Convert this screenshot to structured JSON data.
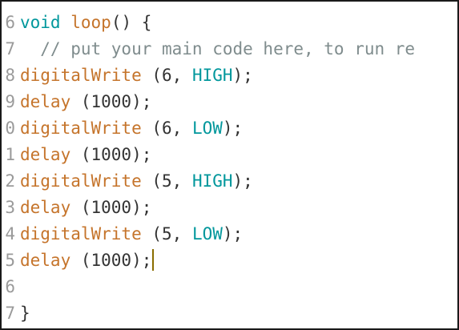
{
  "lines": [
    {
      "num": "6",
      "parts": [
        "void",
        " ",
        "loop",
        "() {"
      ]
    },
    {
      "num": "7",
      "comment": "  // put your main code here, to run re"
    },
    {
      "num": "8",
      "fn": "digitalWrite",
      "args": " (6, ",
      "const": "HIGH",
      "end": ");"
    },
    {
      "num": "9",
      "fn": "delay",
      "args": " (1000);"
    },
    {
      "num": "0",
      "fn": "digitalWrite",
      "args": " (6, ",
      "const": "LOW",
      "end": ");"
    },
    {
      "num": "1",
      "fn": "delay",
      "args": " (1000);"
    },
    {
      "num": "2",
      "fn": "digitalWrite",
      "args": " (5, ",
      "const": "HIGH",
      "end": ");"
    },
    {
      "num": "3",
      "fn": "delay",
      "args": " (1000);"
    },
    {
      "num": "4",
      "fn": "digitalWrite",
      "args": " (5, ",
      "const": "LOW",
      "end": ");"
    },
    {
      "num": "5",
      "fn": "delay",
      "args": " (1000);"
    },
    {
      "num": "6",
      "blank": ""
    },
    {
      "num": "7",
      "close": "}"
    }
  ],
  "colors": {
    "keyword": "#00979c",
    "function": "#c5742b",
    "comment": "#7f8c8d",
    "constant": "#00979c",
    "text": "#333333",
    "gutter": "#9a9a9a",
    "caret": "#8a6d00"
  }
}
